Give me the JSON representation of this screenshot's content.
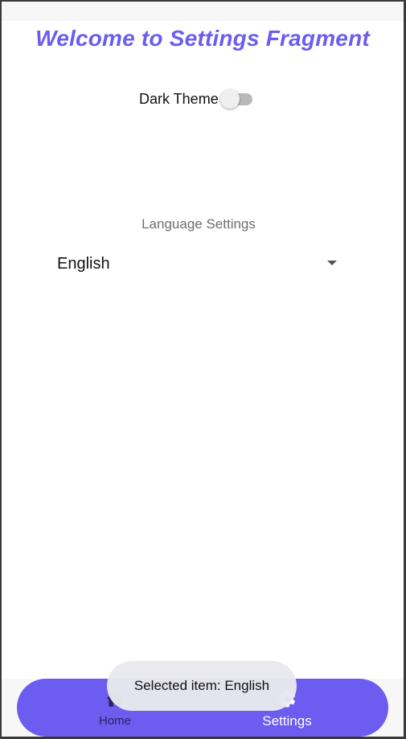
{
  "header": {
    "title": "Welcome to Settings Fragment"
  },
  "theme": {
    "label": "Dark Theme",
    "enabled": false
  },
  "language": {
    "section_label": "Language Settings",
    "selected": "English"
  },
  "bottom_nav": {
    "items": [
      {
        "label": "Home",
        "icon": "home-icon",
        "active": false
      },
      {
        "label": "Settings",
        "icon": "gear-icon",
        "active": true
      }
    ]
  },
  "toast": {
    "message": "Selected item: English"
  },
  "colors": {
    "accent": "#6c5cf0",
    "switch_track": "#b9b9b9",
    "toast_bg": "#e8e8ee"
  }
}
